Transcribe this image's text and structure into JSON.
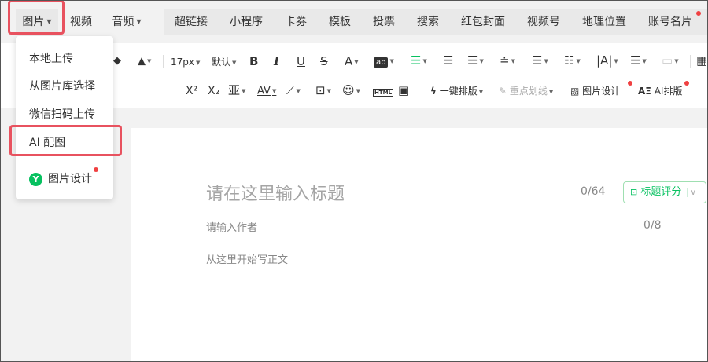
{
  "insert_bar": {
    "left_tabs": [
      {
        "label": "图片",
        "has_caret": true
      },
      {
        "label": "视频",
        "has_caret": false
      },
      {
        "label": "音频",
        "has_caret": true
      }
    ],
    "right_tabs": [
      "超链接",
      "小程序",
      "卡券",
      "模板",
      "投票",
      "搜索",
      "红包封面",
      "视频号",
      "地理位置",
      "账号名片"
    ]
  },
  "toolbar": {
    "font_size": "17px",
    "font_default": "默认",
    "bold": "B",
    "italic": "I",
    "underline": "U",
    "strike": "S",
    "font_color": "A",
    "highlight": "ab",
    "superscript": "X²",
    "subscript": "X₂",
    "html_icon": "HTML",
    "one_click_layout": "一键排版",
    "emphasis_line": "重点划线",
    "image_design": "图片设计",
    "ai_layout": "AI排版",
    "ai_layout_icon": "AΞ"
  },
  "image_menu": {
    "items": [
      "本地上传",
      "从图片库选择",
      "微信扫码上传",
      "AI 配图"
    ],
    "image_design_label": "图片设计",
    "image_design_badge": "Y"
  },
  "editor": {
    "title_placeholder": "请在这里输入标题",
    "title_count": "0/64",
    "title_score_label": "标题评分",
    "author_placeholder": "请输入作者",
    "author_count": "0/8",
    "body_placeholder": "从这里开始写正文"
  },
  "colors": {
    "accent_green": "#07c160",
    "highlight_red": "#e8525f",
    "notify_red": "#f04142"
  }
}
